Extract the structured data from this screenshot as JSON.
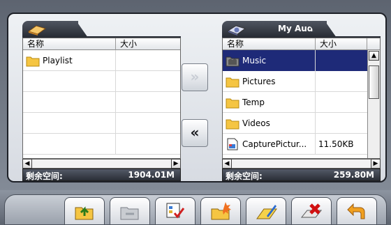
{
  "left_panel": {
    "tab_title": "",
    "columns": {
      "name": "名称",
      "size": "大小"
    },
    "rows": [
      {
        "name": "Playlist",
        "size": "",
        "icon": "folder-icon"
      },
      {
        "name": "",
        "size": "",
        "icon": ""
      },
      {
        "name": "",
        "size": "",
        "icon": ""
      },
      {
        "name": "",
        "size": "",
        "icon": ""
      },
      {
        "name": "",
        "size": "",
        "icon": ""
      }
    ],
    "free_label": "剩余空间:",
    "free_value": "1904.01M"
  },
  "right_panel": {
    "tab_title": "My Audio",
    "columns": {
      "name": "名称",
      "size": "大小"
    },
    "rows": [
      {
        "name": "Music",
        "size": "",
        "icon": "music-folder-icon",
        "selected": true
      },
      {
        "name": "Pictures",
        "size": "",
        "icon": "folder-icon"
      },
      {
        "name": "Temp",
        "size": "",
        "icon": "folder-icon"
      },
      {
        "name": "Videos",
        "size": "",
        "icon": "folder-icon"
      },
      {
        "name": "CapturePictur...",
        "size": "11.50KB",
        "icon": "image-file-icon"
      }
    ],
    "free_label": "剩余空间:",
    "free_value": "259.80M"
  },
  "transfer": {
    "copy_right_label": "»",
    "copy_left_label": "«"
  },
  "toolbar": {
    "tools": [
      "up-folder-icon",
      "back-folder-icon",
      "select-all-icon",
      "new-folder-icon",
      "rename-icon",
      "delete-icon",
      "return-icon"
    ]
  },
  "colors": {
    "selection": "#1e2a78",
    "panel_dark": "#2a2e36",
    "background": "#7a8290"
  }
}
